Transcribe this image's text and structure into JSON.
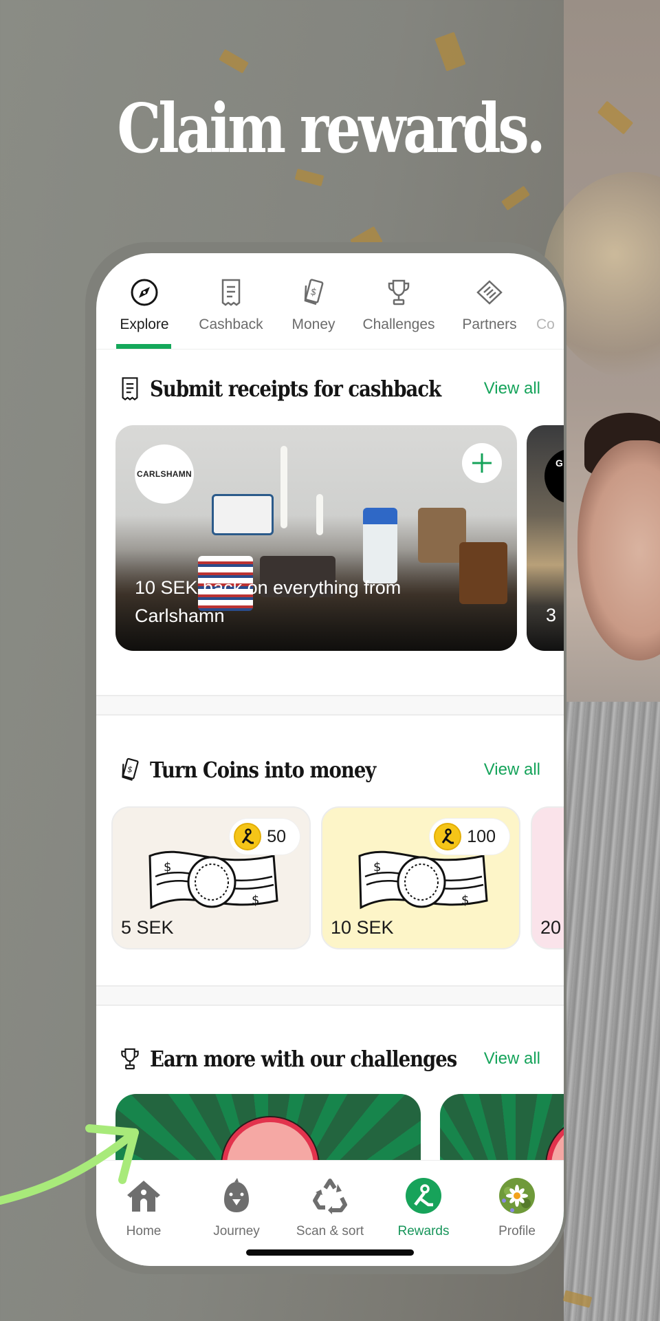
{
  "headline": "Claim rewards.",
  "colors": {
    "accent_green": "#15a35a",
    "tab_underline": "#14a85a",
    "arrow_green": "#a8ea7a",
    "challenge_green": "#23653f",
    "coin_yellow": "#f5c518"
  },
  "top_tabs": [
    {
      "label": "Explore",
      "icon": "compass-icon",
      "active": true
    },
    {
      "label": "Cashback",
      "icon": "receipt-icon",
      "active": false
    },
    {
      "label": "Money",
      "icon": "money-icon",
      "active": false
    },
    {
      "label": "Challenges",
      "icon": "trophy-icon",
      "active": false
    },
    {
      "label": "Partners",
      "icon": "handshake-icon",
      "active": false
    },
    {
      "label": "Co",
      "icon": "",
      "active": false
    }
  ],
  "sections": {
    "cashback": {
      "title": "Submit receipts for cashback",
      "icon": "receipt-icon",
      "view_all": "View all",
      "cards": [
        {
          "brand": "CARLSHAMN",
          "title": "10 SEK back on everything from Carlshamn",
          "action_icon": "plus-icon"
        },
        {
          "brand": "G M G",
          "title": "3"
        }
      ]
    },
    "money": {
      "title": "Turn Coins into money",
      "icon": "money-icon",
      "view_all": "View all",
      "cards": [
        {
          "amount": "5 SEK",
          "coins": "50",
          "bg": "#f6f1ea"
        },
        {
          "amount": "10 SEK",
          "coins": "100",
          "bg": "#fdf5c8"
        },
        {
          "amount": "20",
          "coins": "",
          "bg": "#fae3ea"
        }
      ]
    },
    "challenges": {
      "title": "Earn more with our challenges",
      "icon": "trophy-icon",
      "view_all": "View all"
    }
  },
  "bottom_nav": [
    {
      "label": "Home",
      "icon": "home-icon",
      "active": false
    },
    {
      "label": "Journey",
      "icon": "bird-icon",
      "active": false
    },
    {
      "label": "Scan & sort",
      "icon": "recycle-icon",
      "active": false
    },
    {
      "label": "Rewards",
      "icon": "rewards-icon",
      "active": true
    },
    {
      "label": "Profile",
      "icon": "avatar",
      "active": false
    }
  ]
}
